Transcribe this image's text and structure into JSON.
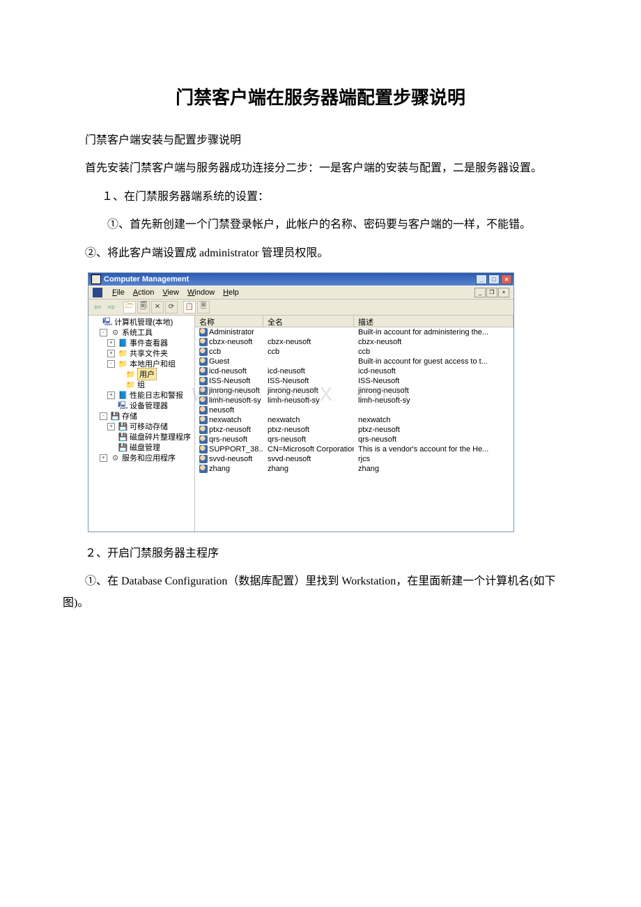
{
  "doc": {
    "title": "门禁客户端在服务器端配置步骤说明",
    "p1": "门禁客户端安装与配置步骤说明",
    "p2": "首先安装门禁客户端与服务器成功连接分二步：一是客户端的安装与配置，二是服务器设置。",
    "p3": "１、在门禁服务器端系统的设置：",
    "p4": "①、首先新创建一个门禁登录帐户，此帐户的名称、密码要与客户端的一样，不能错。",
    "p5": "②、将此客户端设置成 administrator 管理员权限。",
    "p6": "２、开启门禁服务器主程序",
    "p7": "①、在 Database Configuration（数据库配置）里找到 Workstation，在里面新建一个计算机名(如下图)。"
  },
  "win": {
    "title": "Computer Management",
    "menu": {
      "file": "File",
      "action": "Action",
      "view": "View",
      "window": "Window",
      "help": "Help"
    },
    "toolbar": {
      "back": "⇦",
      "fwd": "⇨",
      "up": "🗁",
      "props": "🗐",
      "refresh": "⟳",
      "export": "📋",
      "help": "?"
    }
  },
  "tree": [
    {
      "ind": 0,
      "pm": "",
      "icon": "pc",
      "label": "计算机管理(本地)"
    },
    {
      "ind": 1,
      "pm": "-",
      "icon": "gear",
      "label": "系统工具"
    },
    {
      "ind": 2,
      "pm": "+",
      "icon": "book",
      "label": "事件查看器"
    },
    {
      "ind": 2,
      "pm": "+",
      "icon": "folder",
      "label": "共享文件夹"
    },
    {
      "ind": 2,
      "pm": "-",
      "icon": "folder",
      "label": "本地用户和组"
    },
    {
      "ind": 3,
      "pm": "",
      "icon": "folder",
      "label": "用户",
      "sel": true
    },
    {
      "ind": 3,
      "pm": "",
      "icon": "folder",
      "label": "组"
    },
    {
      "ind": 2,
      "pm": "+",
      "icon": "book",
      "label": "性能日志和警报"
    },
    {
      "ind": 2,
      "pm": "",
      "icon": "pc",
      "label": "设备管理器"
    },
    {
      "ind": 1,
      "pm": "-",
      "icon": "disk",
      "label": "存储"
    },
    {
      "ind": 2,
      "pm": "+",
      "icon": "disk",
      "label": "可移动存储"
    },
    {
      "ind": 2,
      "pm": "",
      "icon": "disk",
      "label": "磁盘碎片整理程序"
    },
    {
      "ind": 2,
      "pm": "",
      "icon": "disk",
      "label": "磁盘管理"
    },
    {
      "ind": 1,
      "pm": "+",
      "icon": "gear",
      "label": "服务和应用程序"
    }
  ],
  "cols": {
    "name": "名称",
    "full": "全名",
    "desc": "描述"
  },
  "users": [
    {
      "name": "Administrator",
      "full": "",
      "desc": "Built-in account for administering the..."
    },
    {
      "name": "cbzx-neusoft",
      "full": "cbzx-neusoft",
      "desc": "cbzx-neusoft"
    },
    {
      "name": "ccb",
      "full": "ccb",
      "desc": "ccb"
    },
    {
      "name": "Guest",
      "full": "",
      "desc": "Built-in account for guest access to t..."
    },
    {
      "name": "icd-neusoft",
      "full": "icd-neusoft",
      "desc": "icd-neusoft"
    },
    {
      "name": "ISS-Neusoft",
      "full": "ISS-Neusoft",
      "desc": "ISS-Neusoft"
    },
    {
      "name": "jinrong-neusoft",
      "full": "jinrong-neusoft",
      "desc": "jinrong-neusoft"
    },
    {
      "name": "limh-neusoft-sy",
      "full": "limh-neusoft-sy",
      "desc": "limh-neusoft-sy"
    },
    {
      "name": "neusoft",
      "full": "",
      "desc": ""
    },
    {
      "name": "nexwatch",
      "full": "nexwatch",
      "desc": "nexwatch"
    },
    {
      "name": "ptxz-neusoft",
      "full": "ptxz-neusoft",
      "desc": "ptxz-neusoft"
    },
    {
      "name": "qrs-neusoft",
      "full": "qrs-neusoft",
      "desc": "qrs-neusoft"
    },
    {
      "name": "SUPPORT_38...",
      "full": "CN=Microsoft Corporation...",
      "desc": "This is a vendor's account for the He..."
    },
    {
      "name": "svvd-neusoft",
      "full": "svvd-neusoft",
      "desc": "rjcs"
    },
    {
      "name": "zhang",
      "full": "zhang",
      "desc": "zhang"
    }
  ]
}
